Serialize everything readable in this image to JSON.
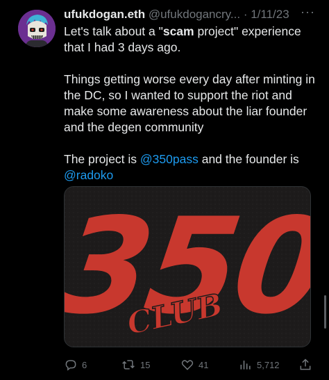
{
  "tweet": {
    "display_name": "ufukdogan.eth",
    "handle": "@ufukdogancry...",
    "separator": "·",
    "date": "1/11/23",
    "more_label": "···",
    "line1_pre": "Let's talk about a \"",
    "line1_bold": "scam",
    "line1_post": " project\" experience that I had 3 days ago.",
    "paragraph2": "Things getting worse every day after minting in the DC, so I wanted to support the riot and make some awareness about the liar founder and the degen community",
    "p3_pre": "The project is ",
    "p3_mention1": "@350pass",
    "p3_mid": " and the founder is ",
    "p3_mention2": "@radoko",
    "image": {
      "logo_number": "350",
      "logo_sub": "CLUB",
      "accent": "#c8382e"
    },
    "actions": {
      "replies": "6",
      "retweets": "15",
      "likes": "41",
      "views": "5,712"
    }
  }
}
